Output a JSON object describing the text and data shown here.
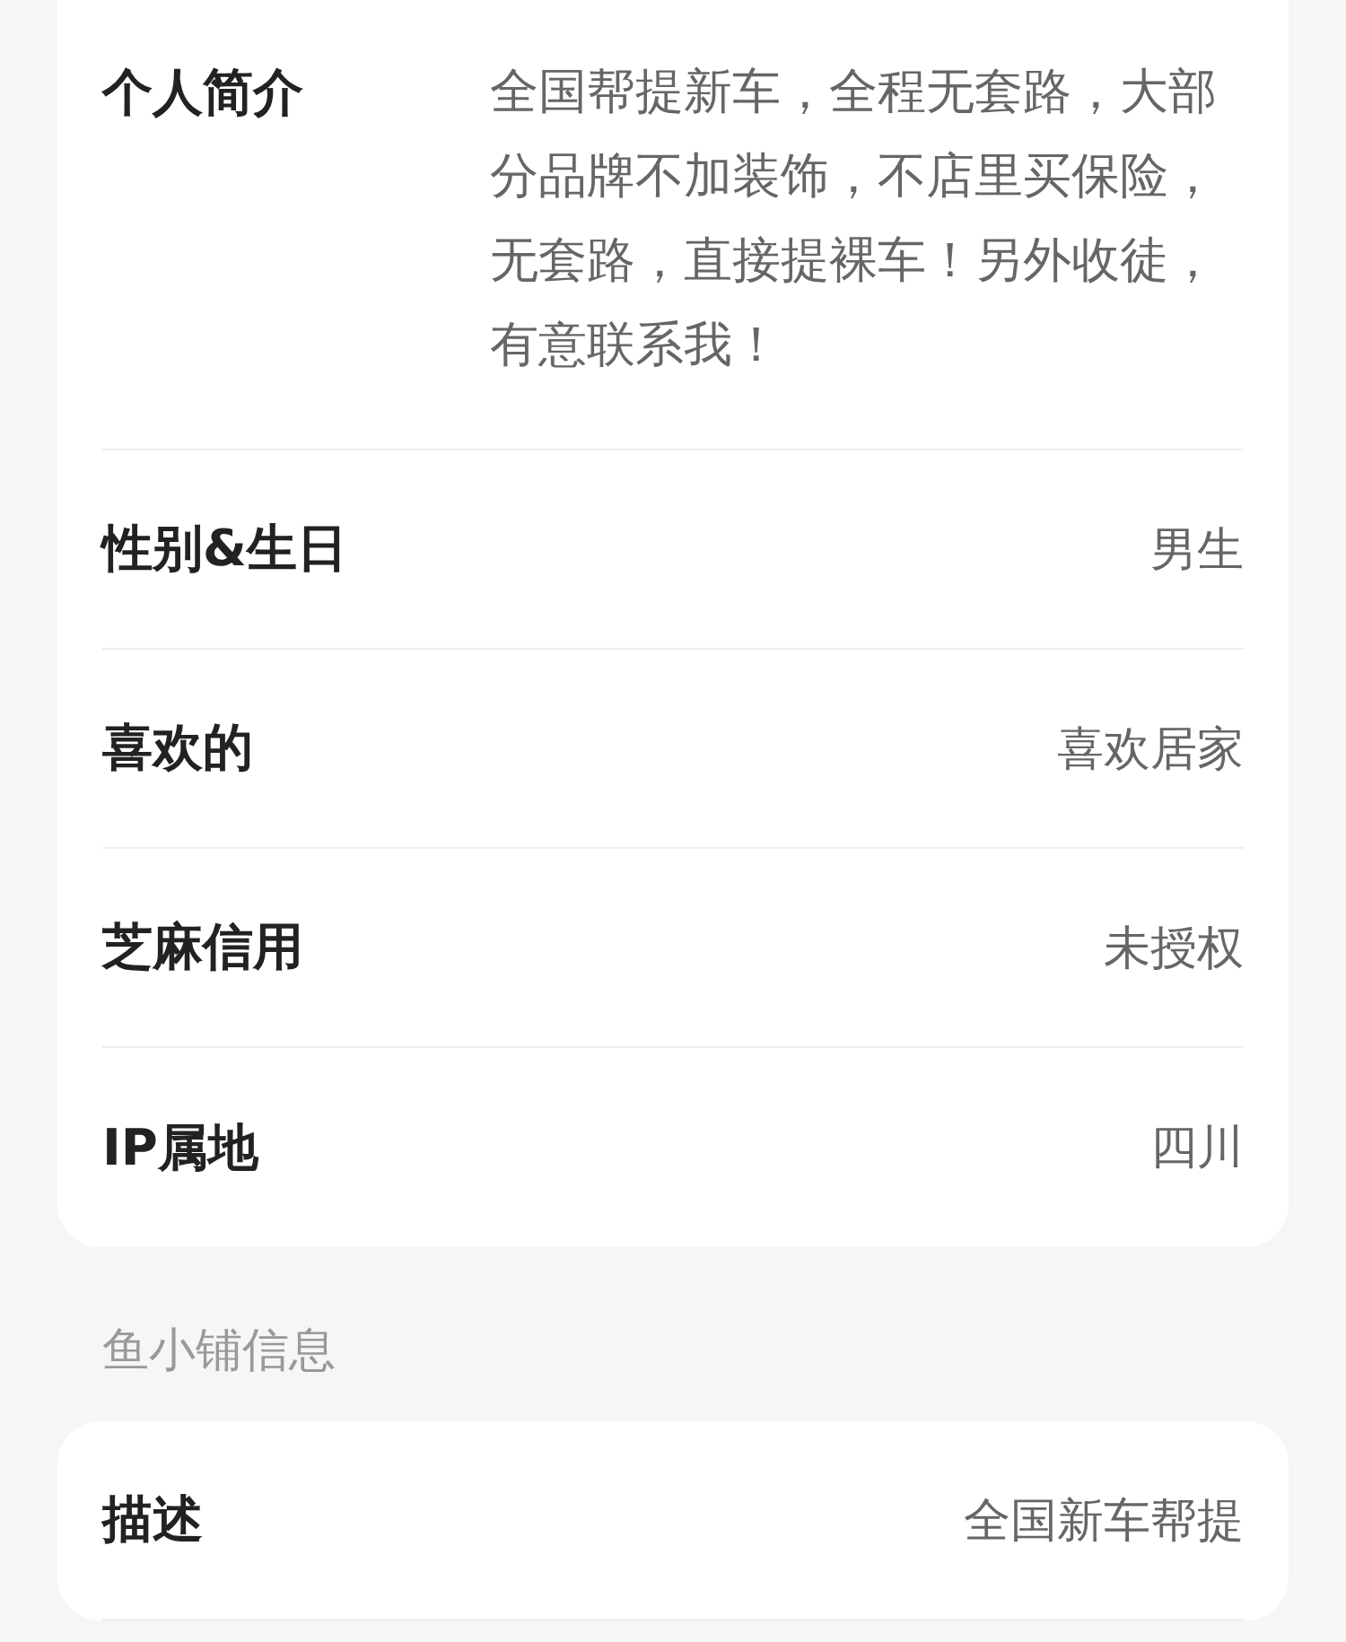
{
  "profile_rows": [
    {
      "label": "个人简介",
      "value": "全国帮提新车，全程无套路，大部分品牌不加装饰，不店里买保险，无套路，直接提裸车！另外收徒，有意联系我！"
    },
    {
      "label": "性别&生日",
      "value": "男生"
    },
    {
      "label": "喜欢的",
      "value": "喜欢居家"
    },
    {
      "label": "芝麻信用",
      "value": "未授权"
    },
    {
      "label": "IP属地",
      "value": "四川"
    }
  ],
  "shop_section": {
    "title": "鱼小铺信息",
    "rows": [
      {
        "label": "描述",
        "value": "全国新车帮提"
      }
    ]
  }
}
